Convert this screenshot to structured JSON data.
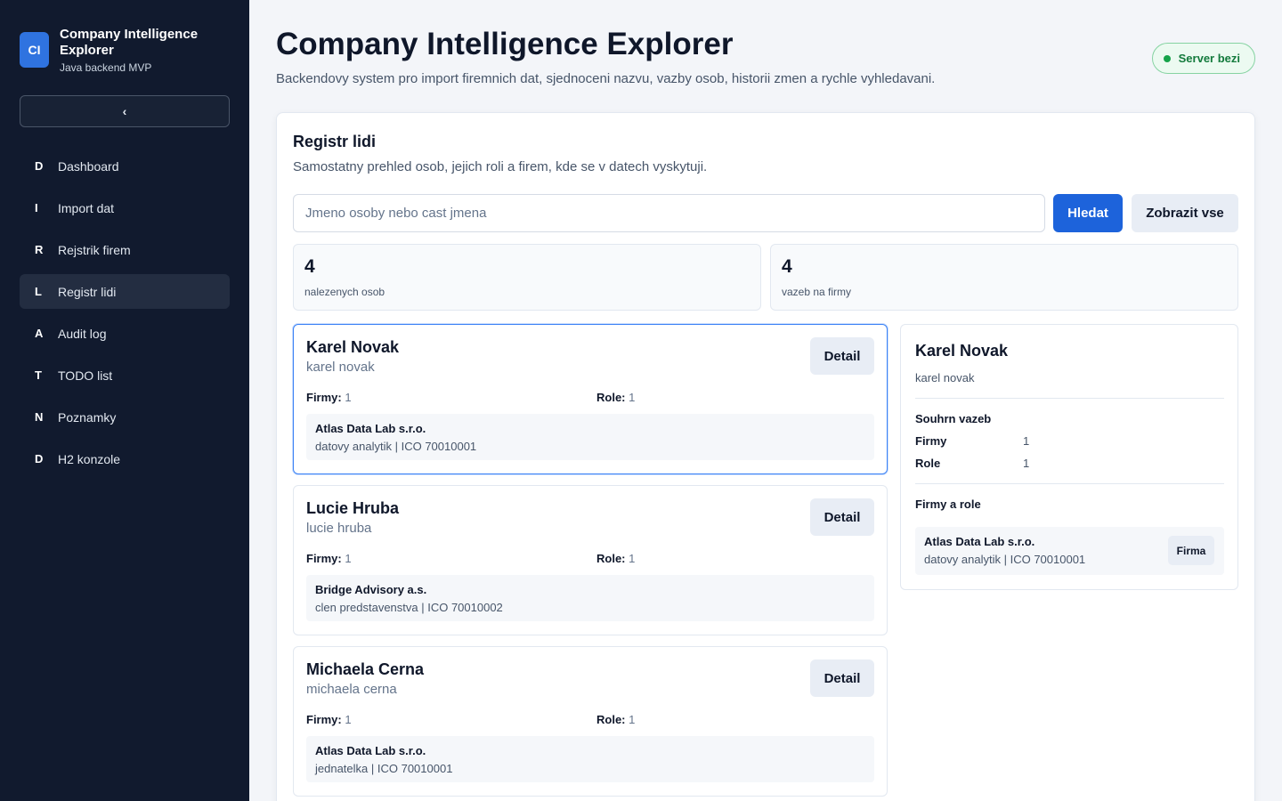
{
  "app": {
    "logo": "CI",
    "title": "Company Intelligence Explorer",
    "subtitle": "Java backend MVP",
    "collapse_label": "‹"
  },
  "nav": [
    {
      "letter": "D",
      "label": "Dashboard"
    },
    {
      "letter": "I",
      "label": "Import dat"
    },
    {
      "letter": "R",
      "label": "Rejstrik firem"
    },
    {
      "letter": "L",
      "label": "Registr lidi"
    },
    {
      "letter": "A",
      "label": "Audit log"
    },
    {
      "letter": "T",
      "label": "TODO list"
    },
    {
      "letter": "N",
      "label": "Poznamky"
    },
    {
      "letter": "D",
      "label": "H2 konzole"
    }
  ],
  "nav_active": "Registr lidi",
  "header": {
    "title": "Company Intelligence Explorer",
    "subtitle": "Backendovy system pro import firemnich dat, sjednoceni nazvu, vazby osob, historii zmen a rychle vyhledavani.",
    "status": "Server bezi"
  },
  "panel": {
    "title": "Registr lidi",
    "subtitle": "Samostatny prehled osob, jejich roli a firem, kde se v datech vyskytuji.",
    "search_placeholder": "Jmeno osoby nebo cast jmena",
    "search_value": "",
    "search_button": "Hledat",
    "show_all_button": "Zobrazit vse"
  },
  "stats": [
    {
      "value": "4",
      "label": "nalezenych osob"
    },
    {
      "value": "4",
      "label": "vazeb na firmy"
    }
  ],
  "people": [
    {
      "name": "Karel Novak",
      "normalized": "karel novak",
      "detail_label": "Detail",
      "firmy_label": "Firmy:",
      "firmy": "1",
      "role_label": "Role:",
      "role": "1",
      "company": "Atlas Data Lab s.r.o.",
      "company_info": "datovy analytik | ICO 70010001"
    },
    {
      "name": "Lucie Hruba",
      "normalized": "lucie hruba",
      "detail_label": "Detail",
      "firmy_label": "Firmy:",
      "firmy": "1",
      "role_label": "Role:",
      "role": "1",
      "company": "Bridge Advisory a.s.",
      "company_info": "clen predstavenstva | ICO 70010002"
    },
    {
      "name": "Michaela Cerna",
      "normalized": "michaela cerna",
      "detail_label": "Detail",
      "firmy_label": "Firmy:",
      "firmy": "1",
      "role_label": "Role:",
      "role": "1",
      "company": "Atlas Data Lab s.r.o.",
      "company_info": "jednatelka | ICO 70010001"
    }
  ],
  "detail": {
    "name": "Karel Novak",
    "normalized": "karel novak",
    "summary_title": "Souhrn vazeb",
    "firmy_label": "Firmy",
    "firmy": "1",
    "role_label": "Role",
    "role": "1",
    "companies_title": "Firmy a role",
    "company": "Atlas Data Lab s.r.o.",
    "company_info": "datovy analytik | ICO 70010001",
    "company_badge": "Firma"
  },
  "colors": {
    "sidebar_bg": "#111a2e",
    "accent": "#1d63db",
    "status_green": "#137a3c"
  }
}
